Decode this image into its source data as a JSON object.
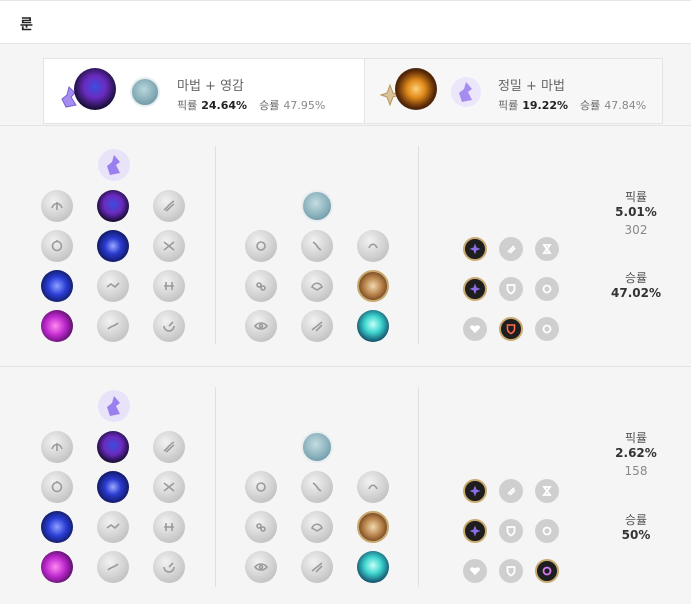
{
  "header": {
    "title": "룬"
  },
  "tabs": [
    {
      "name": "마법 + 영감",
      "pick_label": "픽률",
      "pick": "24.64%",
      "win_label": "승률",
      "win": "47.95%"
    },
    {
      "name": "정밀 + 마법",
      "pick_label": "픽률",
      "pick": "19.22%",
      "win_label": "승률",
      "win": "47.84%"
    }
  ],
  "pages": [
    {
      "pick_label": "픽률",
      "pick": "5.01%",
      "count": "302",
      "win_label": "승률",
      "win": "47.02%"
    },
    {
      "pick_label": "픽률",
      "pick": "2.62%",
      "count": "158",
      "win_label": "승률",
      "win": "50%"
    }
  ],
  "colors": {
    "sorcery": "#8b6ee8",
    "inspiration": "#49a6c0",
    "precision": "#c8aa6e",
    "shard_active": "#6b4fd8"
  }
}
